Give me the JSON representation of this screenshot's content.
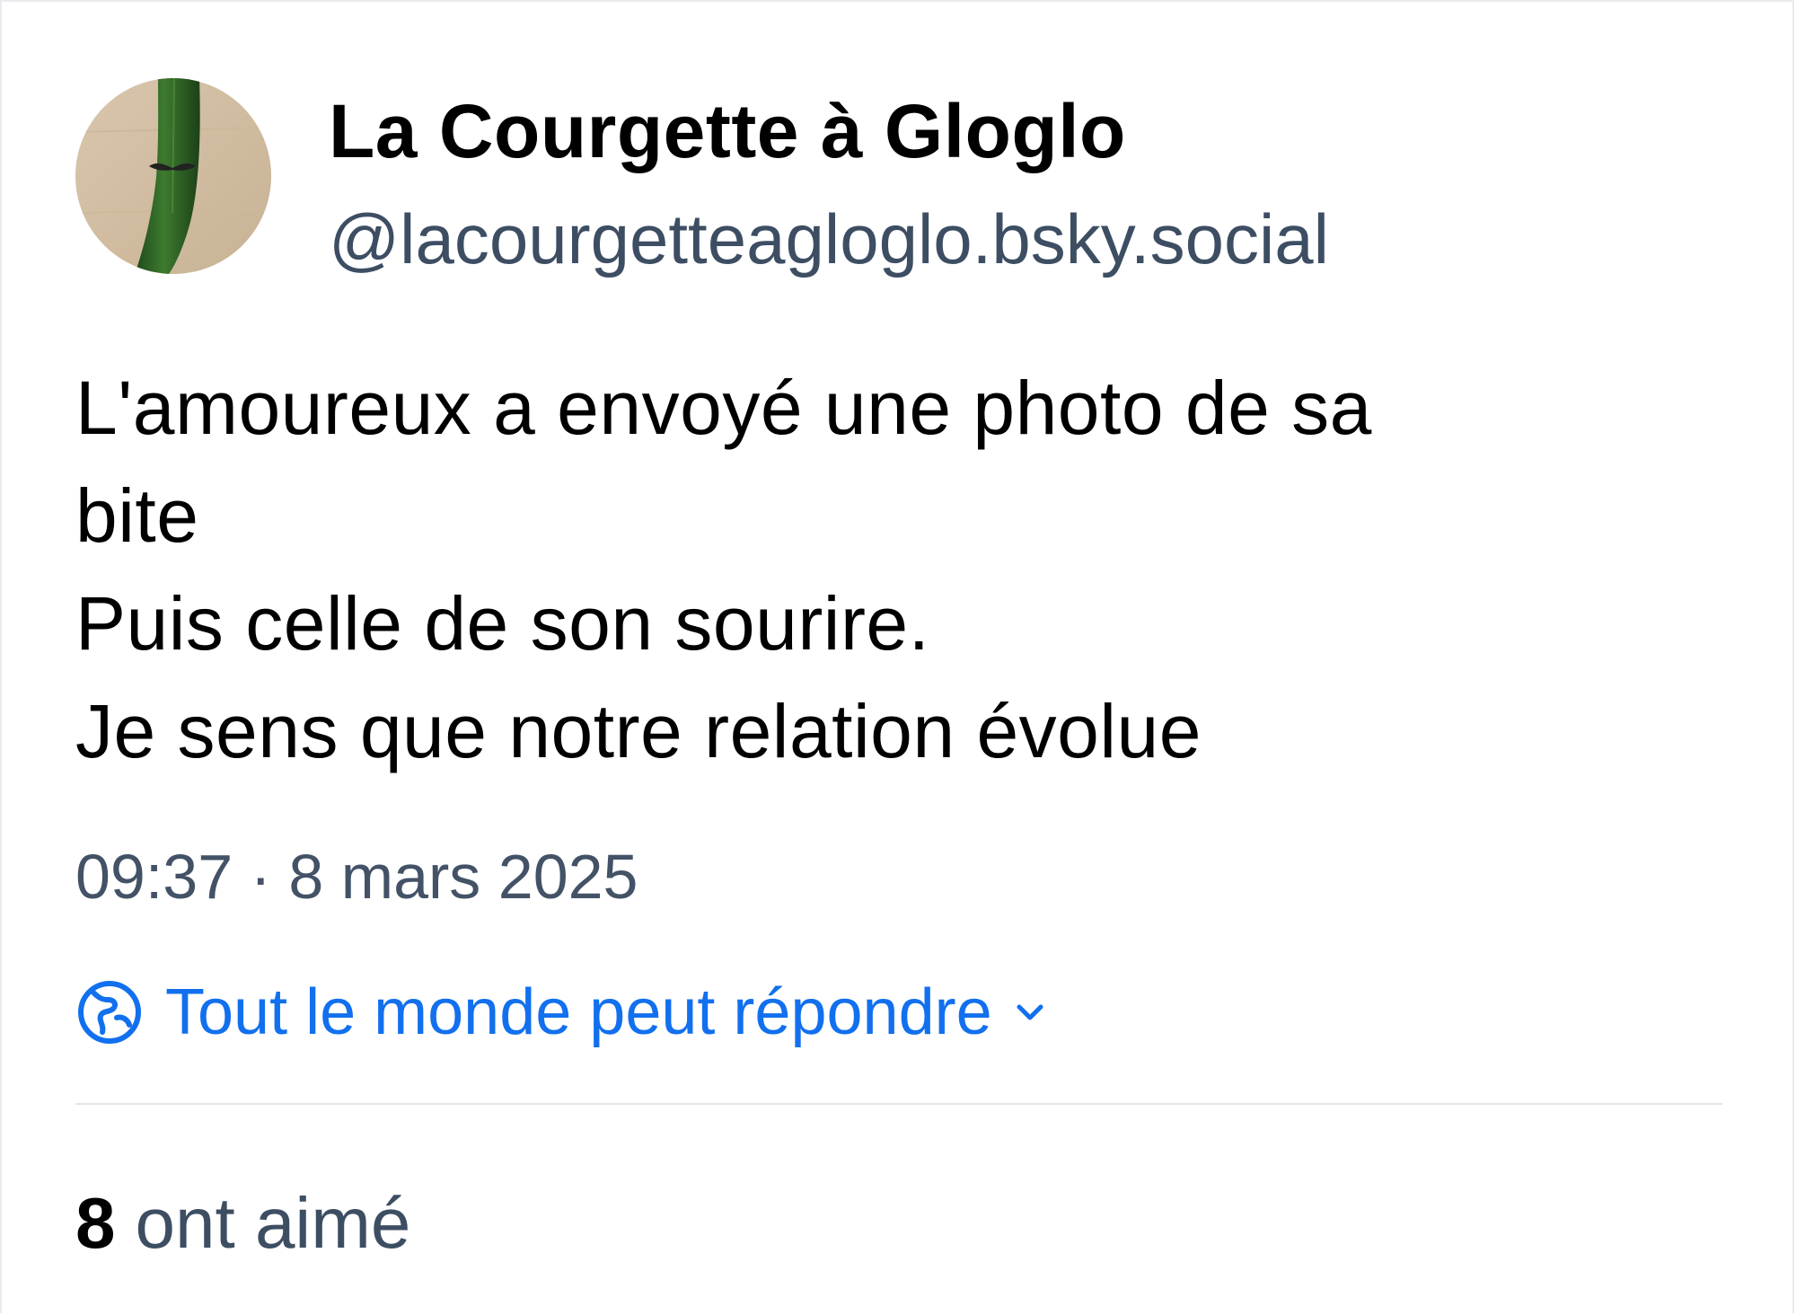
{
  "post": {
    "author": {
      "display_name": "La Courgette à Gloglo",
      "handle": "@lacourgetteagloglo.bsky.social",
      "avatar_icon": "zucchini-with-mustache-avatar"
    },
    "text_lines": [
      "L'amoureux a envoyé une photo de sa",
      "bite",
      "Puis celle de son sourire.",
      "Je sens que notre relation évolue"
    ],
    "timestamp": "09:37 · 8 mars 2025",
    "reply_setting": {
      "label": "Tout le monde peut répondre",
      "icon": "globe-icon",
      "chevron": "chevron-down-icon"
    },
    "likes": {
      "count": "8",
      "label": "ont aimé"
    }
  },
  "colors": {
    "text": "#000000",
    "secondary_text": "#3d4e63",
    "accent": "#1270ee",
    "divider": "#e3e6ea"
  }
}
